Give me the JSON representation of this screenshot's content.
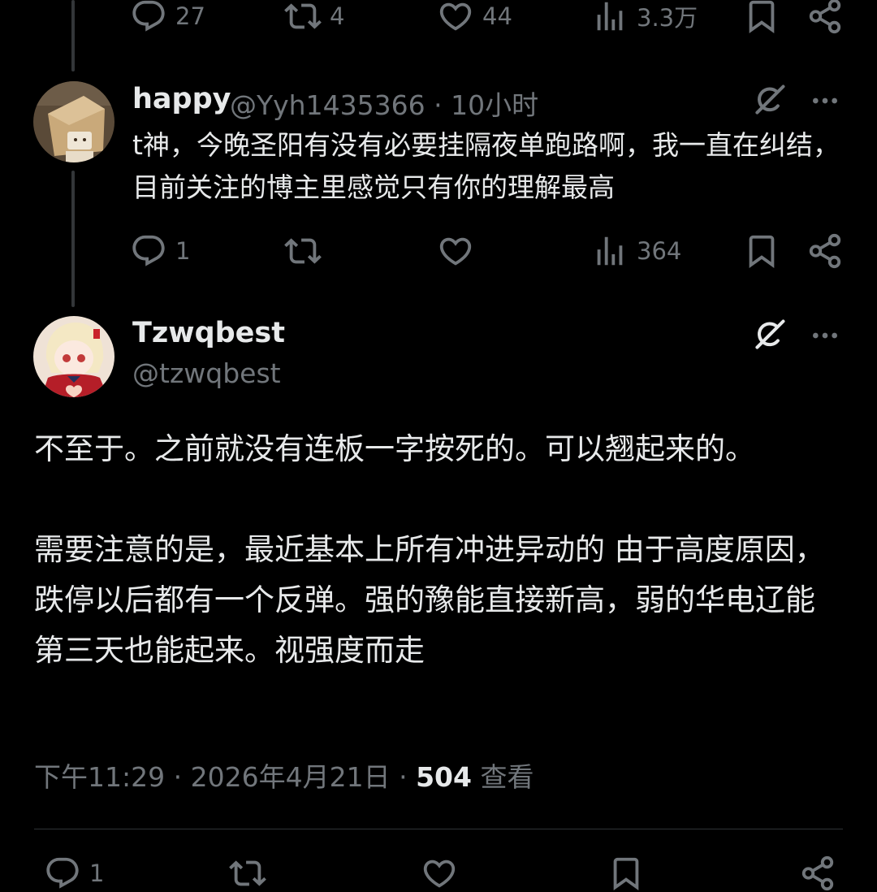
{
  "top_actions": {
    "replies": "27",
    "retweets": "4",
    "likes": "44",
    "views": "3.3万"
  },
  "reply": {
    "display_name": "happy",
    "handle": "@Yyh1435366",
    "separator": "·",
    "time": "10小时",
    "text": "t神，今晚圣阳有没有必要挂隔夜单跑路啊，我一直在纠结，目前关注的博主里感觉只有你的理解最高",
    "actions": {
      "replies": "1",
      "retweets": "",
      "likes": "",
      "views": "364"
    }
  },
  "main_post": {
    "display_name": "Tzwqbest",
    "handle": "@tzwqbest",
    "paragraphs": [
      "不至于。之前就没有连板一字按死的。可以翘起来的。",
      "需要注意的是，最近基本上所有冲进异动的 由于高度原因，跌停以后都有一个反弹。强的豫能直接新高，弱的华电辽能第三天也能起来。视强度而走"
    ],
    "time": "下午11:29",
    "date": "2026年4月21日",
    "separator": "·",
    "views_count": "504",
    "views_label": "查看",
    "bottom_actions": {
      "replies": "1"
    }
  },
  "icons": {
    "reply": "reply-icon",
    "retweet": "retweet-icon",
    "like": "heart-icon",
    "views": "views-bar-icon",
    "bookmark": "bookmark-icon",
    "share": "share-icon",
    "grok": "grok-icon",
    "more": "more-icon"
  },
  "colors": {
    "background": "#000000",
    "text_primary": "#e7e9ea",
    "text_secondary": "#71767b",
    "divider": "#2f3336"
  }
}
